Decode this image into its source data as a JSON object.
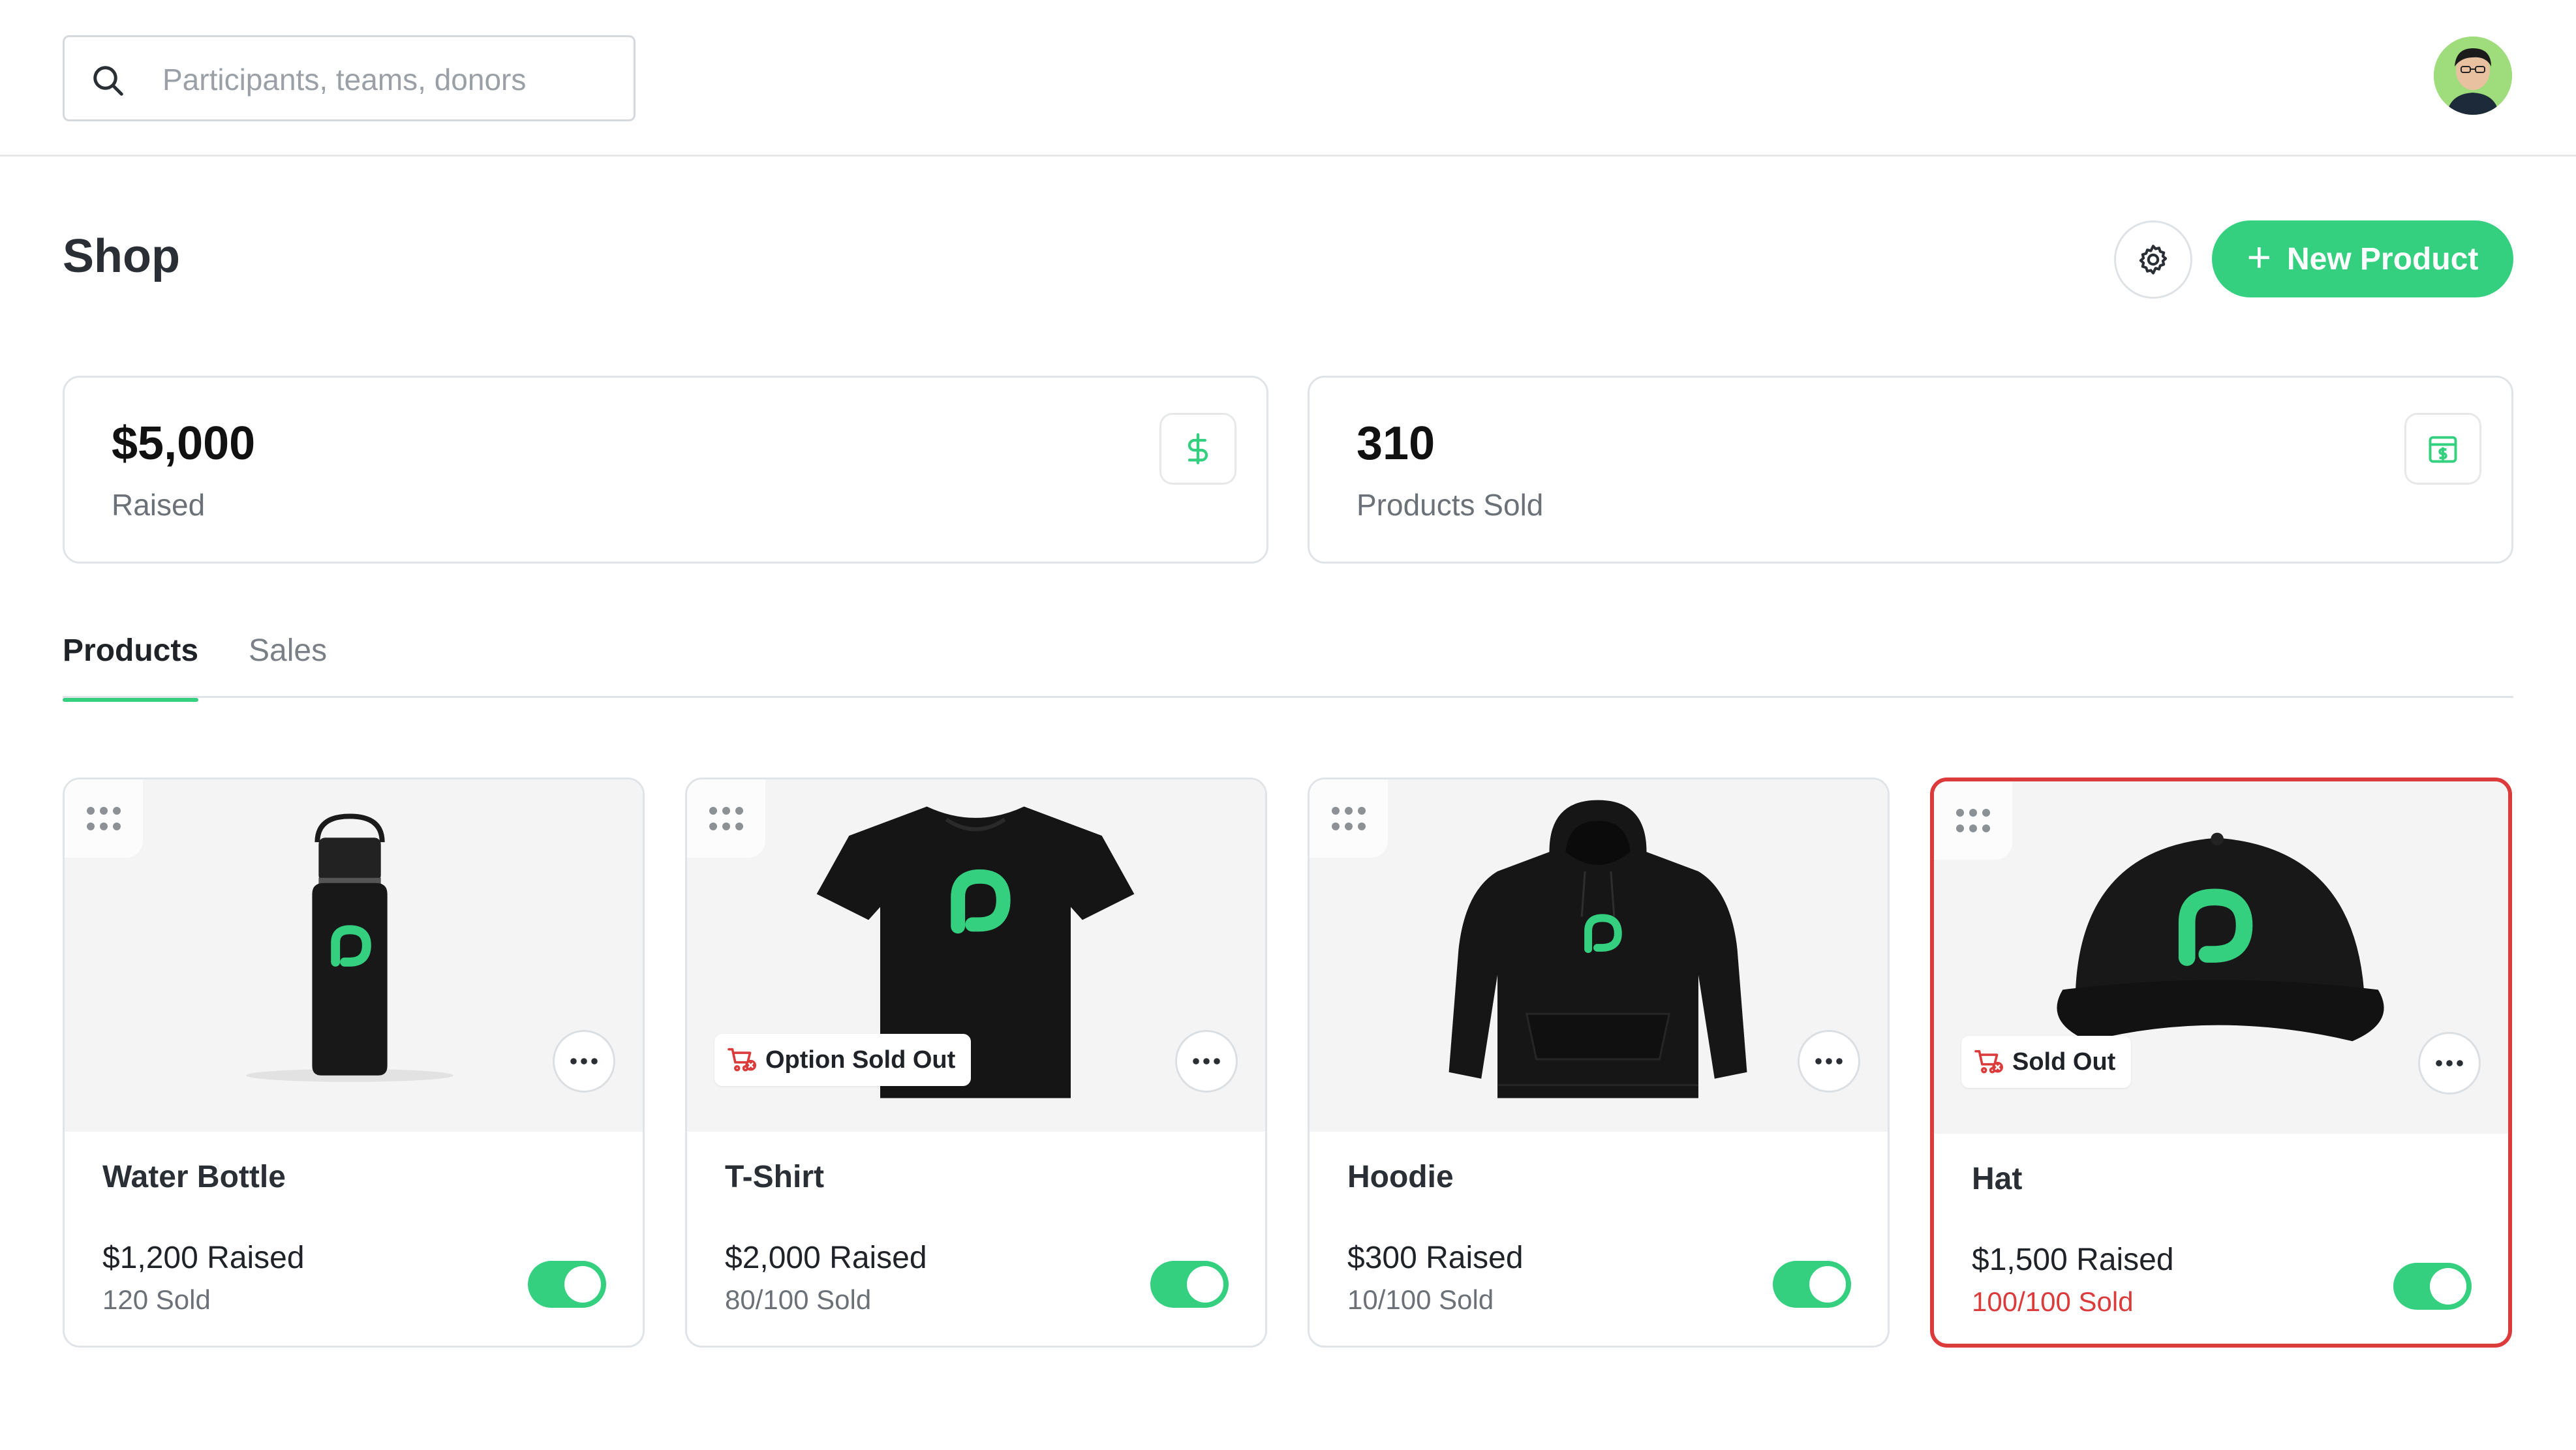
{
  "search": {
    "placeholder": "Participants, teams, donors"
  },
  "header": {
    "title": "Shop",
    "new_product_label": "New Product"
  },
  "stats": [
    {
      "value": "$5,000",
      "label": "Raised"
    },
    {
      "value": "310",
      "label": "Products Sold"
    }
  ],
  "tabs": [
    {
      "label": "Products",
      "active": true
    },
    {
      "label": "Sales",
      "active": false
    }
  ],
  "products": [
    {
      "name": "Water Bottle",
      "raised": "$1,200 Raised",
      "sold": "120 Sold",
      "badge": "",
      "enabled": true
    },
    {
      "name": "T-Shirt",
      "raised": "$2,000 Raised",
      "sold": "80/100 Sold",
      "badge": "Option Sold Out",
      "enabled": true
    },
    {
      "name": "Hoodie",
      "raised": "$300 Raised",
      "sold": "10/100 Sold",
      "badge": "",
      "enabled": true
    },
    {
      "name": "Hat",
      "raised": "$1,500 Raised",
      "sold": "100/100 Sold",
      "badge": "Sold Out",
      "enabled": true
    }
  ],
  "colors": {
    "accent": "#34d07f",
    "danger": "#dc3b3b",
    "border": "#e1e4e7"
  },
  "icons": [
    "search-icon",
    "gear-icon",
    "plus-icon",
    "dollar-icon",
    "package-dollar-icon",
    "drag-handle-icon",
    "more-icon",
    "cart-x-icon"
  ]
}
